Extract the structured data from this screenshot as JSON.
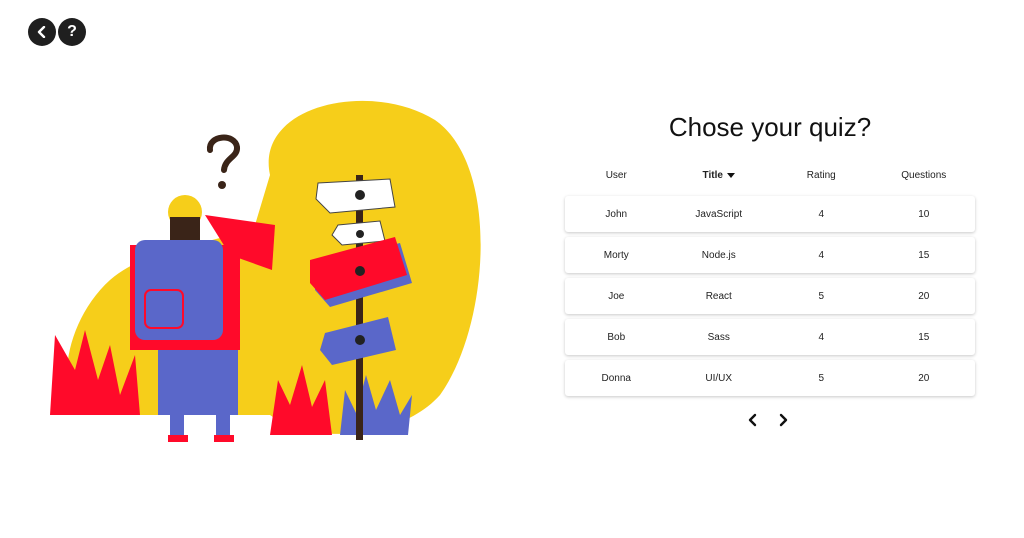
{
  "header": {
    "help_label": "?"
  },
  "main": {
    "title": "Chose your quiz?"
  },
  "table": {
    "headers": [
      "User",
      "Title",
      "Rating",
      "Questions"
    ],
    "rows": [
      [
        "John",
        "JavaScript",
        "4",
        "10"
      ],
      [
        "Morty",
        "Node.js",
        "4",
        "15"
      ],
      [
        "Joe",
        "React",
        "5",
        "20"
      ],
      [
        "Bob",
        "Sass",
        "4",
        "15"
      ],
      [
        "Donna",
        "UI/UX",
        "5",
        "20"
      ]
    ]
  },
  "colors": {
    "accent_yellow": "#F6CE1A",
    "accent_red": "#FF0A2A",
    "accent_blue": "#5A67C9",
    "dark": "#1f1f1f"
  },
  "icons": {
    "back": "chevron-left-icon",
    "help": "question-icon",
    "prev": "chevron-left-icon",
    "next": "chevron-right-icon"
  }
}
